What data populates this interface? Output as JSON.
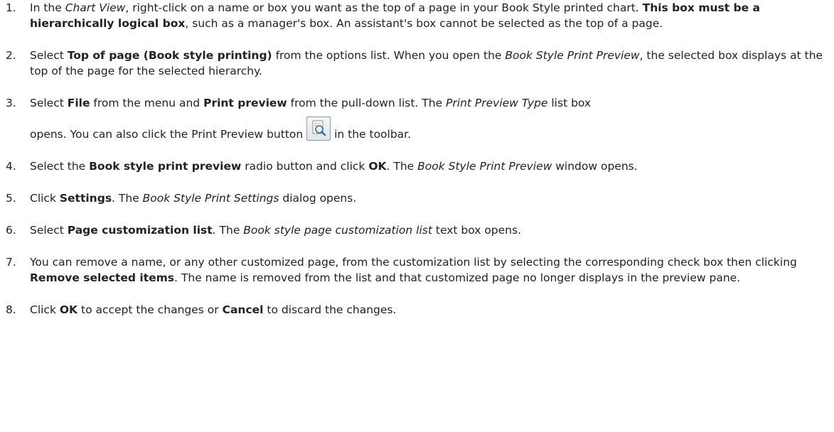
{
  "steps": [
    {
      "num": "1.",
      "parts": [
        {
          "t": "In the "
        },
        {
          "t": "Chart View",
          "s": "i"
        },
        {
          "t": ", right-click on a name or box you want as the top of a page in your Book Style printed chart. "
        },
        {
          "t": "This box must be a hierarchically logical box",
          "s": "b"
        },
        {
          "t": ", such as a manager's box. An assistant's box cannot be selected as the top of a page."
        }
      ]
    },
    {
      "num": "2.",
      "parts": [
        {
          "t": "Select "
        },
        {
          "t": "Top of page (Book style printing)",
          "s": "b"
        },
        {
          "t": " from the options list. When you open the "
        },
        {
          "t": "Book Style Print Preview",
          "s": "i"
        },
        {
          "t": ", the selected box displays at the top of the page for the selected hierarchy."
        }
      ]
    },
    {
      "num": "3.",
      "line1": [
        {
          "t": "Select "
        },
        {
          "t": "File",
          "s": "b"
        },
        {
          "t": " from the menu and "
        },
        {
          "t": "Print preview",
          "s": "b"
        },
        {
          "t": " from the pull-down list. The "
        },
        {
          "t": "Print Preview Type",
          "s": "i"
        },
        {
          "t": " list box"
        }
      ],
      "line2_before": "opens. You can also click the Print Preview button ",
      "line2_after": " in the toolbar.",
      "icon": "print-preview-icon"
    },
    {
      "num": "4.",
      "parts": [
        {
          "t": "Select the "
        },
        {
          "t": "Book style print preview",
          "s": "b"
        },
        {
          "t": " radio button and click "
        },
        {
          "t": "OK",
          "s": "b"
        },
        {
          "t": ". The "
        },
        {
          "t": "Book Style Print Preview",
          "s": "i"
        },
        {
          "t": " window opens."
        }
      ]
    },
    {
      "num": "5.",
      "parts": [
        {
          "t": "Click "
        },
        {
          "t": "Settings",
          "s": "b"
        },
        {
          "t": ". The "
        },
        {
          "t": "Book Style Print Settings",
          "s": "i"
        },
        {
          "t": " dialog opens."
        }
      ]
    },
    {
      "num": "6.",
      "parts": [
        {
          "t": "Select "
        },
        {
          "t": "Page customization list",
          "s": "b"
        },
        {
          "t": ". The "
        },
        {
          "t": "Book style page customization list",
          "s": "i"
        },
        {
          "t": " text box opens."
        }
      ]
    },
    {
      "num": "7.",
      "parts": [
        {
          "t": "You can remove a name, or any other customized page, from the customization list by selecting the corresponding check box then clicking "
        },
        {
          "t": "Remove selected items",
          "s": "b"
        },
        {
          "t": ". The name is removed from the list and that customized page no longer displays in the preview pane."
        }
      ]
    },
    {
      "num": "8.",
      "parts": [
        {
          "t": "Click "
        },
        {
          "t": "OK",
          "s": "b"
        },
        {
          "t": " to accept the changes or "
        },
        {
          "t": "Cancel",
          "s": "b"
        },
        {
          "t": " to discard the changes."
        }
      ]
    }
  ]
}
